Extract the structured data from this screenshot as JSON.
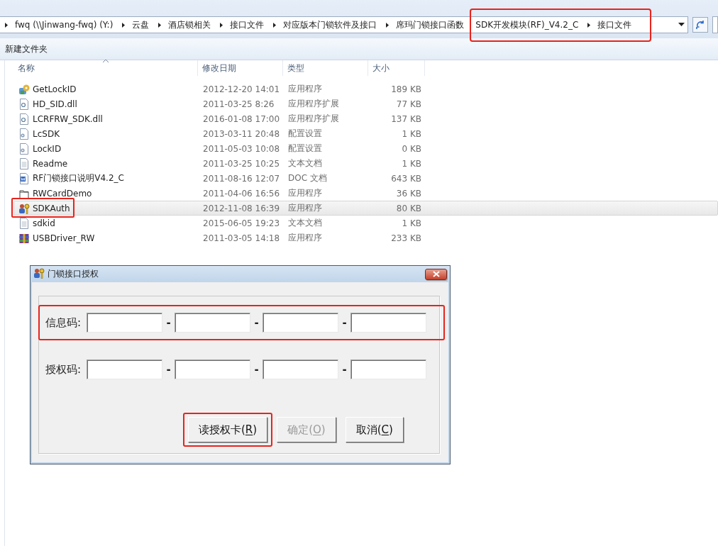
{
  "address_bar": {
    "crumbs": [
      {
        "label": "fwq (\\\\Jinwang-fwq) (Y:)",
        "highlighted": false
      },
      {
        "label": "云盘",
        "highlighted": false
      },
      {
        "label": "酒店锁相关",
        "highlighted": false
      },
      {
        "label": "接口文件",
        "highlighted": false
      },
      {
        "label": "对应版本门锁软件及接口",
        "highlighted": false
      },
      {
        "label": "席玛门锁接口函数",
        "highlighted": false
      },
      {
        "label": "SDK开发模块(RF)_V4.2_C",
        "highlighted": true
      },
      {
        "label": "接口文件",
        "highlighted": true
      }
    ]
  },
  "toolbar": {
    "buttons": [
      "新建文件夹"
    ]
  },
  "file_list": {
    "columns": [
      "名称",
      "修改日期",
      "类型",
      "大小"
    ],
    "rows": [
      {
        "kind": "gear-app",
        "name": "GetLockID",
        "modified": "2012-12-20 14:01",
        "type": "应用程序",
        "size": "189 KB",
        "selected": false,
        "highlighted": false
      },
      {
        "kind": "dll",
        "name": "HD_SID.dll",
        "modified": "2011-03-25 8:26",
        "type": "应用程序扩展",
        "size": "77 KB",
        "selected": false,
        "highlighted": false
      },
      {
        "kind": "dll",
        "name": "LCRFRW_SDK.dll",
        "modified": "2016-01-08 17:00",
        "type": "应用程序扩展",
        "size": "137 KB",
        "selected": false,
        "highlighted": false
      },
      {
        "kind": "ini",
        "name": "LcSDK",
        "modified": "2013-03-11 20:48",
        "type": "配置设置",
        "size": "1 KB",
        "selected": false,
        "highlighted": false
      },
      {
        "kind": "ini",
        "name": "LockID",
        "modified": "2011-05-03 10:08",
        "type": "配置设置",
        "size": "0 KB",
        "selected": false,
        "highlighted": false
      },
      {
        "kind": "txt",
        "name": "Readme",
        "modified": "2011-03-25 10:25",
        "type": "文本文档",
        "size": "1 KB",
        "selected": false,
        "highlighted": false
      },
      {
        "kind": "doc",
        "name": "RF门锁接口说明V4.2_C",
        "modified": "2011-08-16 12:07",
        "type": "DOC 文档",
        "size": "643 KB",
        "selected": false,
        "highlighted": false
      },
      {
        "kind": "window-app",
        "name": "RWCardDemo",
        "modified": "2011-04-06 16:56",
        "type": "应用程序",
        "size": "36 KB",
        "selected": false,
        "highlighted": false
      },
      {
        "kind": "key-app",
        "name": "SDKAuth",
        "modified": "2012-11-08 16:39",
        "type": "应用程序",
        "size": "80 KB",
        "selected": true,
        "highlighted": true
      },
      {
        "kind": "txt",
        "name": "sdkid",
        "modified": "2015-06-05 19:23",
        "type": "文本文档",
        "size": "1 KB",
        "selected": false,
        "highlighted": false
      },
      {
        "kind": "archive",
        "name": "USBDriver_RW",
        "modified": "2011-03-05 14:18",
        "type": "应用程序",
        "size": "233 KB",
        "selected": false,
        "highlighted": false
      }
    ]
  },
  "dialog": {
    "title": "门锁接口授权",
    "code_rows": [
      {
        "label": "信息码:",
        "separators": [
          "-",
          "-",
          "-"
        ],
        "highlighted": true
      },
      {
        "label": "授权码:",
        "separators": [
          "-",
          "-",
          "-"
        ],
        "highlighted": false
      }
    ],
    "buttons": [
      {
        "label_parts": [
          "读授权卡(",
          "R",
          ")"
        ],
        "disabled": false,
        "highlighted": true
      },
      {
        "label_parts": [
          "确定(",
          "O",
          ")"
        ],
        "disabled": true,
        "highlighted": false
      },
      {
        "label_parts": [
          "取消(",
          "C",
          ")"
        ],
        "disabled": false,
        "highlighted": false
      }
    ]
  }
}
